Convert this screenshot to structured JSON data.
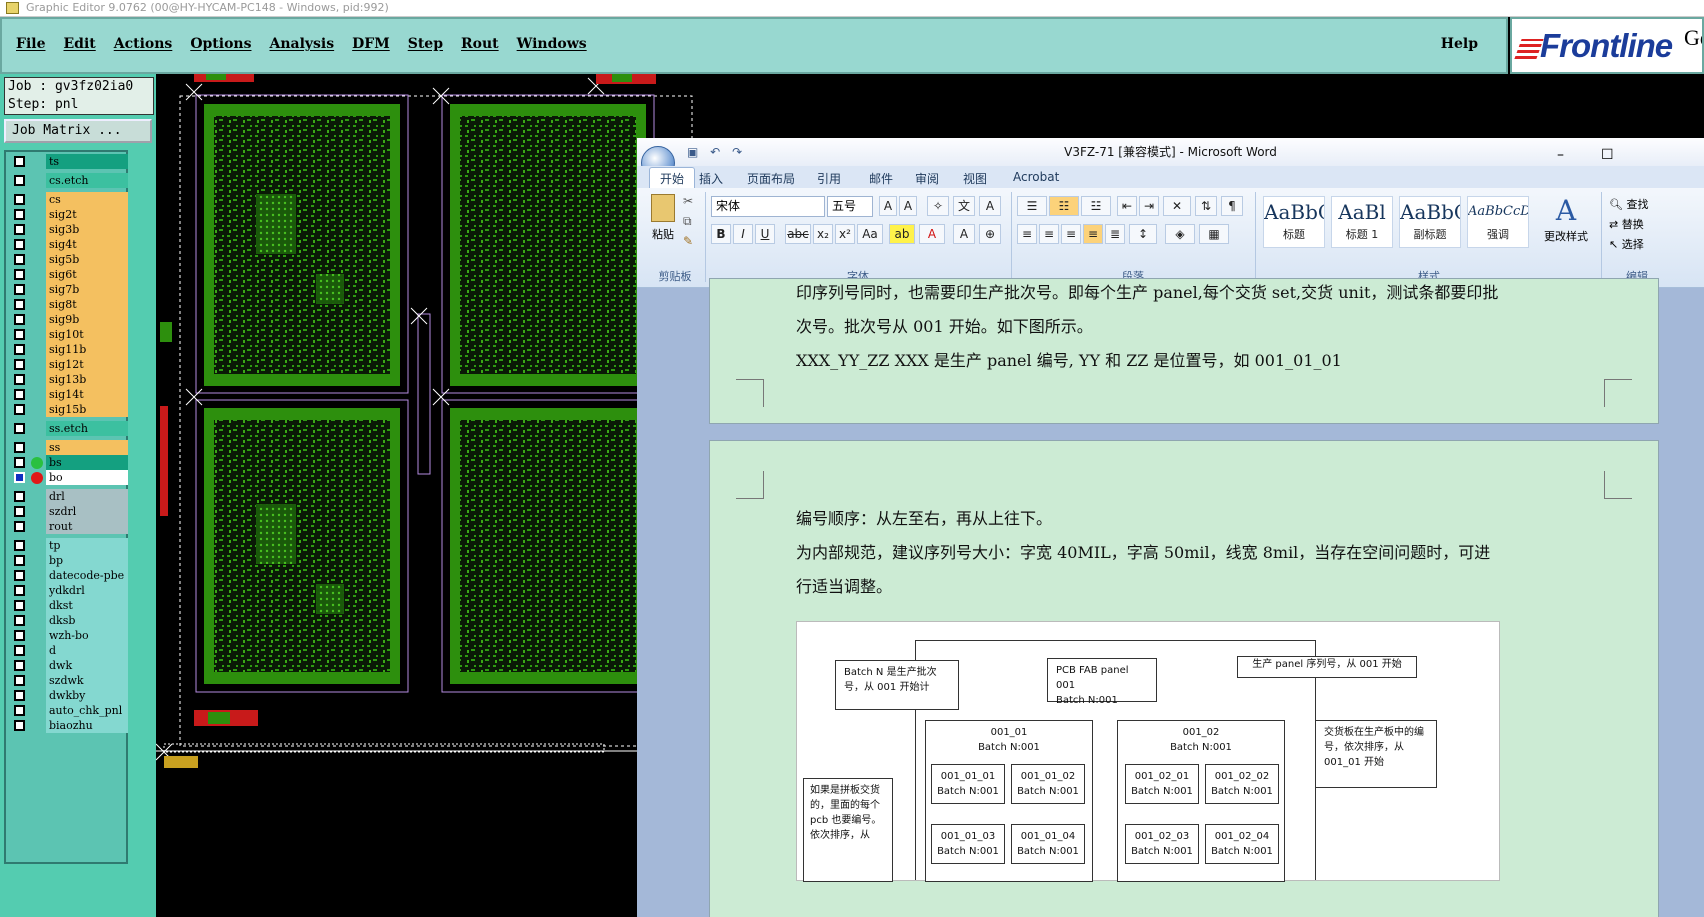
{
  "window": {
    "title": "Graphic Editor 9.0762 (00@HY-HYCAM-PC148 - Windows, pid:992)"
  },
  "menu": {
    "items": [
      "File",
      "Edit",
      "Actions",
      "Options",
      "Analysis",
      "DFM",
      "Step",
      "Rout",
      "Windows"
    ],
    "help": "Help"
  },
  "brand": {
    "name": "Frontline",
    "suffix": "Ge"
  },
  "job": {
    "job_line": "Job : gv3fz02ia0",
    "step_line": "Step: pnl",
    "matrix_button": "Job Matrix ..."
  },
  "layers": [
    {
      "name": "ts",
      "color": "darkteal",
      "dot": ""
    },
    {
      "name": "cs.etch",
      "color": "green",
      "dot": ""
    },
    {
      "name": "cs",
      "color": "orange",
      "dot": ""
    },
    {
      "name": "sig2t",
      "color": "orange",
      "dot": ""
    },
    {
      "name": "sig3b",
      "color": "orange",
      "dot": ""
    },
    {
      "name": "sig4t",
      "color": "orange",
      "dot": ""
    },
    {
      "name": "sig5b",
      "color": "orange",
      "dot": ""
    },
    {
      "name": "sig6t",
      "color": "orange",
      "dot": ""
    },
    {
      "name": "sig7b",
      "color": "orange",
      "dot": ""
    },
    {
      "name": "sig8t",
      "color": "orange",
      "dot": ""
    },
    {
      "name": "sig9b",
      "color": "orange",
      "dot": ""
    },
    {
      "name": "sig10t",
      "color": "orange",
      "dot": ""
    },
    {
      "name": "sig11b",
      "color": "orange",
      "dot": ""
    },
    {
      "name": "sig12t",
      "color": "orange",
      "dot": ""
    },
    {
      "name": "sig13b",
      "color": "orange",
      "dot": ""
    },
    {
      "name": "sig14t",
      "color": "orange",
      "dot": ""
    },
    {
      "name": "sig15b",
      "color": "orange",
      "dot": ""
    },
    {
      "name": "ss.etch",
      "color": "green",
      "dot": ""
    },
    {
      "name": "ss",
      "color": "orange",
      "dot": ""
    },
    {
      "name": "bs",
      "color": "darkteal",
      "dot": "#2ac040"
    },
    {
      "name": "bo",
      "color": "white",
      "dot": "#e01818"
    },
    {
      "name": "drl",
      "color": "grey",
      "dot": ""
    },
    {
      "name": "szdrl",
      "color": "grey",
      "dot": ""
    },
    {
      "name": "rout",
      "color": "grey",
      "dot": ""
    },
    {
      "name": "tp",
      "color": "light",
      "dot": ""
    },
    {
      "name": "bp",
      "color": "light",
      "dot": ""
    },
    {
      "name": "datecode-pbe",
      "color": "light",
      "dot": ""
    },
    {
      "name": "ydkdrl",
      "color": "light",
      "dot": ""
    },
    {
      "name": "dkst",
      "color": "light",
      "dot": ""
    },
    {
      "name": "dksb",
      "color": "light",
      "dot": ""
    },
    {
      "name": "wzh-bo",
      "color": "light",
      "dot": ""
    },
    {
      "name": "d",
      "color": "light",
      "dot": ""
    },
    {
      "name": "dwk",
      "color": "light",
      "dot": ""
    },
    {
      "name": "szdwk",
      "color": "light",
      "dot": ""
    },
    {
      "name": "dwkby",
      "color": "light",
      "dot": ""
    },
    {
      "name": "auto_chk_pnl",
      "color": "light",
      "dot": ""
    },
    {
      "name": "biaozhu",
      "color": "light",
      "dot": ""
    }
  ],
  "word": {
    "title": "V3FZ-71 [兼容模式] - Microsoft Word",
    "min": "–",
    "max": "☐",
    "tabs": [
      "开始",
      "插入",
      "页面布局",
      "引用",
      "邮件",
      "审阅",
      "视图",
      "Acrobat"
    ],
    "ribbon": {
      "paste": "粘贴",
      "font_name": "宋体",
      "font_size": "五号",
      "groups": [
        "剪贴板",
        "字体",
        "段落",
        "样式",
        "编辑"
      ],
      "styles": [
        {
          "sample": "AaBbC",
          "name": "标题"
        },
        {
          "sample": "AaBl",
          "name": "标题 1"
        },
        {
          "sample": "AaBbC",
          "name": "副标题"
        },
        {
          "sample": "AaBbCcDd",
          "name": "强调"
        }
      ],
      "change_styles": "更改样式",
      "find": "查找",
      "replace": "替换",
      "select": "选择"
    },
    "page1": [
      "印序列号同时，也需要印生产批次号。即每个生产 panel,每个交货 set,交货 unit，测试条都要印批",
      "次号。批次号从 001 开始。如下图所示。",
      "XXX_YY_ZZ    XXX  是生产 panel 编号, YY  和  ZZ    是位置号，如 001_01_01"
    ],
    "page2": [
      "编号顺序：从左至右，再从上往下。",
      "为内部规范，建议序列号大小：字宽 40MIL，字高 50mil，线宽 8mil，当存在空间问题时，可进",
      "行适当调整。"
    ],
    "figure": {
      "batch_note": "Batch  N  是生产批次号，从 001 开始计",
      "pcb_fab": "PCB  FAB  panel  001",
      "batch_n": "Batch N:001",
      "serial_note": "生产 panel  序列号，从 001 开始",
      "set1": "001_01",
      "set2": "001_02",
      "cells": [
        "001_01_01",
        "001_01_02",
        "001_02_01",
        "001_02_02",
        "001_01_03",
        "001_01_04",
        "001_02_03",
        "001_02_04"
      ],
      "delivery_note": "交货板在生产板中的编号，依次排序，从 001_01 开始",
      "panel_note": "如果是拼板交货的，里面的每个 pcb 也要编号。依次排序，从"
    }
  }
}
